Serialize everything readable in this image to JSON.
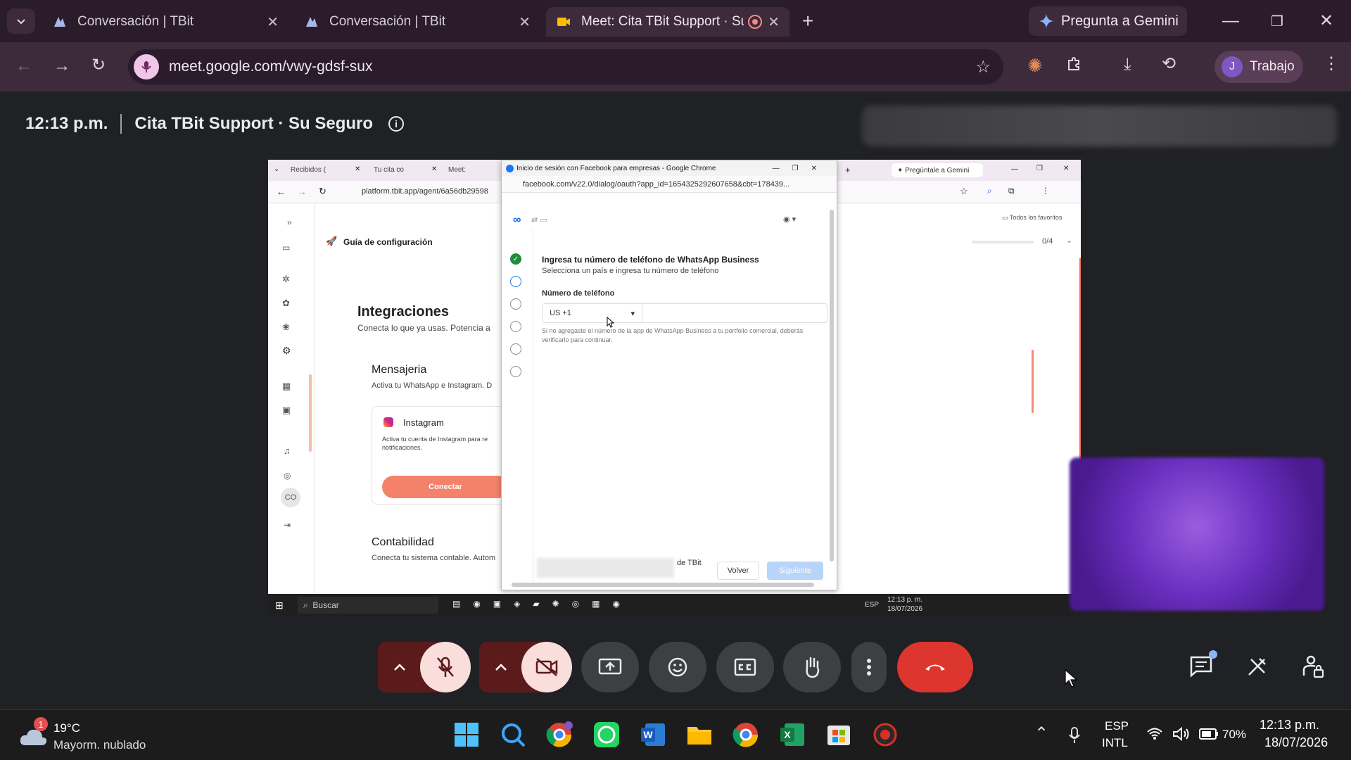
{
  "browser": {
    "tabs": [
      {
        "title": "Conversación | TBit"
      },
      {
        "title": "Conversación | TBit"
      },
      {
        "title": "Meet: Cita TBit Support · Su",
        "active": true
      }
    ],
    "gemini_button": "Pregunta a Gemini",
    "url": "meet.google.com/vwy-gdsf-sux",
    "profile": {
      "initial": "J",
      "name": "Trabajo"
    }
  },
  "meet": {
    "time": "12:13 p.m.",
    "meeting_title": "Cita TBit Support · Su Seguro",
    "controls": [
      "mic-off",
      "camera-off",
      "present",
      "emoji",
      "captions",
      "raise-hand",
      "more",
      "leave"
    ]
  },
  "shared_screen": {
    "tabs": [
      "Recibidos (",
      "Tu cita co",
      "Meet:"
    ],
    "gemini_button": "Pregúntale a Gemini",
    "url": "platform.tbit.app/agent/6a56db29598",
    "favorites": "Todos los favoritos",
    "setup_guide": "Guía de configuración",
    "progress": "0/4",
    "integrations_title": "Integraciones",
    "integrations_sub": "Conecta lo que ya usas. Potencia a",
    "messaging_title": "Mensajeria",
    "messaging_sub": "Activa tu WhatsApp e Instagram. D",
    "instagram_title": "Instagram",
    "instagram_desc": "Activa tu cuenta de Instagram para re notificaciones.",
    "connect_button": "Conectar",
    "accounting_title": "Contabilidad",
    "accounting_sub": "Conecta tu sistema contable. Autom",
    "avatar": "CO",
    "taskbar_search": "Buscar",
    "taskbar_lang": "ESP",
    "taskbar_time": "12:13 p. m.",
    "taskbar_date": "18/07/2026",
    "fb_popup": {
      "title": "Inicio de sesión con Facebook para empresas - Google Chrome",
      "url": "facebook.com/v22.0/dialog/oauth?app_id=1654325292607658&cbt=178439...",
      "heading": "Ingresa tu número de teléfono de WhatsApp Business",
      "subheading": "Selecciona un país e ingresa tu número de teléfono",
      "phone_label": "Número de teléfono",
      "country_code": "US +1",
      "note": "Si no agregaste el número de la app de WhatsApp Business a tu portfolio comercial, deberás verificarlo para continuar.",
      "footer_text": "de TBit",
      "back_button": "Volver",
      "next_button": "Siguiente"
    }
  },
  "taskbar": {
    "weather_temp": "19°C",
    "weather_desc": "Mayorm. nublado",
    "weather_badge": "1",
    "lang_top": "ESP",
    "lang_bottom": "INTL",
    "battery": "70%",
    "time": "12:13 p.m.",
    "date": "18/07/2026"
  }
}
